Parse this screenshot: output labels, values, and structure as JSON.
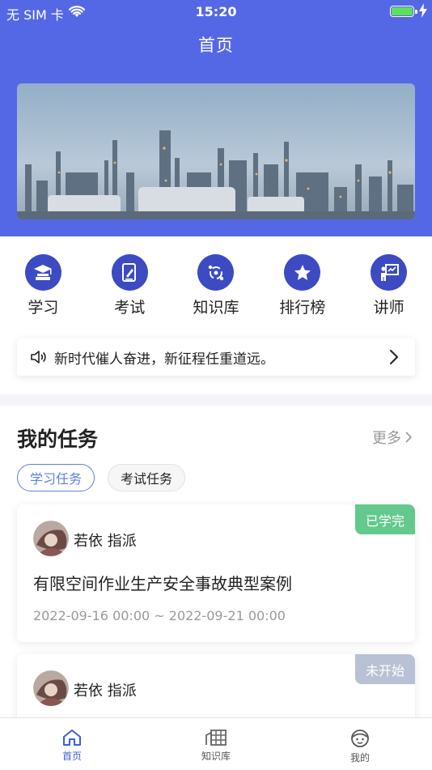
{
  "status_bar": {
    "carrier": "无 SIM 卡",
    "time": "15:20"
  },
  "header": {
    "title": "首页"
  },
  "menu": [
    {
      "label": "学习",
      "icon": "study-icon"
    },
    {
      "label": "考试",
      "icon": "exam-icon"
    },
    {
      "label": "知识库",
      "icon": "knowledge-icon"
    },
    {
      "label": "排行榜",
      "icon": "star-icon"
    },
    {
      "label": "讲师",
      "icon": "lecturer-icon"
    }
  ],
  "notice": {
    "text": "新时代催人奋进，新征程任重道远。"
  },
  "tasks": {
    "title": "我的任务",
    "more": "更多",
    "tabs": [
      {
        "label": "学习任务",
        "active": true
      },
      {
        "label": "考试任务",
        "active": false
      }
    ],
    "cards": [
      {
        "badge": "已学完",
        "assigner": "若依 指派",
        "title": "有限空间作业生产安全事故典型案例",
        "dates": "2022-09-16 00:00 ~ 2022-09-21 00:00"
      },
      {
        "badge": "未开始",
        "assigner": "若依 指派"
      }
    ]
  },
  "tabbar": [
    {
      "label": "首页",
      "active": true
    },
    {
      "label": "知识库",
      "active": false
    },
    {
      "label": "我的",
      "active": false
    }
  ],
  "colors": {
    "primary": "#5468e6",
    "icon_bg": "#3c4bc2",
    "accent": "#5b7fe0",
    "done": "#63c98c",
    "todo": "#b9c1d4"
  }
}
